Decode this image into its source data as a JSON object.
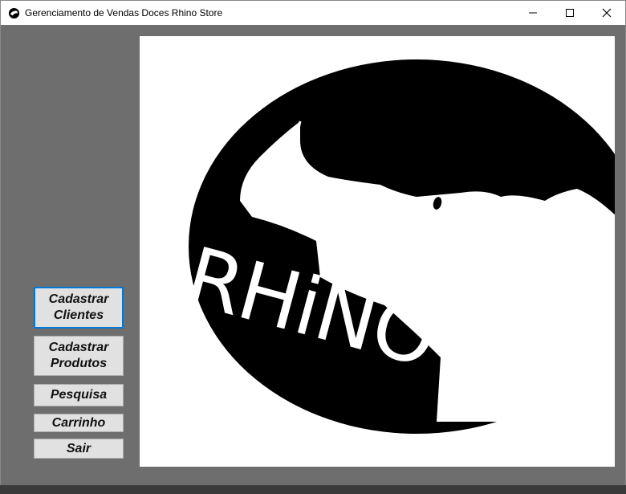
{
  "window": {
    "title": "Gerenciamento de Vendas Doces Rhino Store",
    "controls": [
      "minimize-icon",
      "maximize-icon",
      "close-icon"
    ]
  },
  "logo": {
    "text": "RHiNO"
  },
  "menu": {
    "cadastrar_clientes": "Cadastrar\nClientes",
    "cadastrar_produtos": "Cadastrar\nProdutos",
    "pesquisa": "Pesquisa",
    "carrinho": "Carrinho",
    "sair": "Sair"
  },
  "colors": {
    "background": "#6e6e6e",
    "logo_black": "#000000",
    "button_face": "#e1e1e1",
    "focus_border": "#0078d7"
  }
}
